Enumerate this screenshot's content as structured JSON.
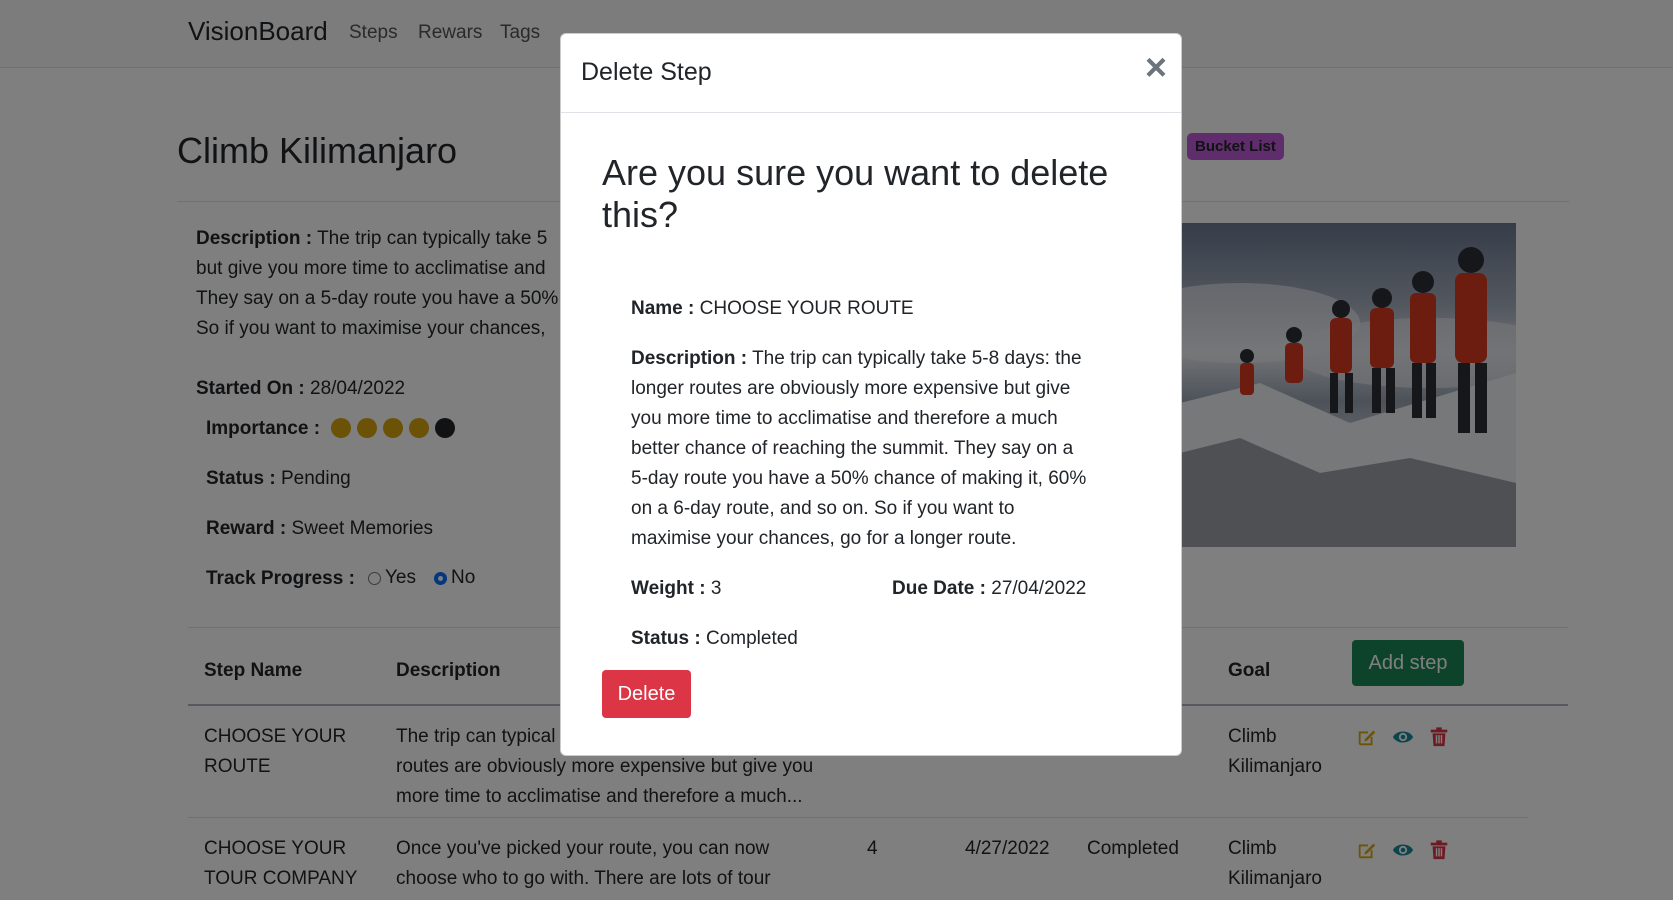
{
  "navbar": {
    "brand": "VisionBoard",
    "links": [
      "Steps",
      "Rewars",
      "Tags"
    ]
  },
  "goal": {
    "title": "Climb Kilimanjaro",
    "tag": "Bucket List",
    "description_label": "Description :",
    "description_lines": [
      "The trip can typically take 5",
      "but give you more time to acclimatise and",
      "They say on a 5-day route you have a 50%",
      "So if you want to maximise your chances,"
    ],
    "started_label": "Started On :",
    "started_on": "28/04/2022",
    "importance_label": "Importance :",
    "importance_level": 4,
    "importance_max": 5,
    "status_label": "Status :",
    "status": "Pending",
    "reward_label": "Reward :",
    "reward": "Sweet Memories",
    "track_label": "Track Progress :",
    "track_yes": "Yes",
    "track_no": "No",
    "track_selected": "No"
  },
  "steps_table": {
    "headers": [
      "Step Name",
      "Description",
      "Goal"
    ],
    "add_button": "Add step",
    "rows": [
      {
        "name_lines": [
          "CHOOSE YOUR",
          "ROUTE"
        ],
        "desc_lines": [
          "The trip can typical",
          "routes are obviously more expensive but give you",
          "more time to acclimatise and therefore a much..."
        ],
        "goal_lines": [
          "Climb",
          "Kilimanjaro"
        ]
      },
      {
        "name_lines": [
          "CHOOSE YOUR",
          "TOUR COMPANY"
        ],
        "desc_lines": [
          "Once you've picked your route, you can now",
          "choose who to go with. There are lots of tour"
        ],
        "weight": "4",
        "due": "4/27/2022",
        "status": "Completed",
        "goal_lines": [
          "Climb",
          "Kilimanjaro"
        ]
      }
    ]
  },
  "modal": {
    "title": "Delete Step",
    "close": "×",
    "confirm": "Are you sure you want to delete this?",
    "name_label": "Name :",
    "name": "CHOOSE YOUR ROUTE",
    "description_label": "Description :",
    "description_lines": [
      "The trip can typically take 5-8 days: the",
      "longer routes are obviously more expensive but give",
      "you more time to acclimatise and therefore a much",
      "better chance of reaching the summit. They say on a",
      "5-day route you have a 50% chance of making it, 60%",
      "on a 6-day route, and so on. So if you want to",
      "maximise your chances, go for a longer route."
    ],
    "weight_label": "Weight :",
    "weight": "3",
    "due_label": "Due Date :",
    "due": "27/04/2022",
    "status_label": "Status :",
    "status": "Completed",
    "delete_button": "Delete"
  },
  "colors": {
    "importance_on": "#d7a50f",
    "importance_off": "#212529",
    "edit_icon": "#d9a60a",
    "view_icon": "#1a8a9b",
    "delete_icon": "#dc3545",
    "delete_button": "#dc3545",
    "add_button": "#198754",
    "tag_badge": "#c05bd8"
  }
}
